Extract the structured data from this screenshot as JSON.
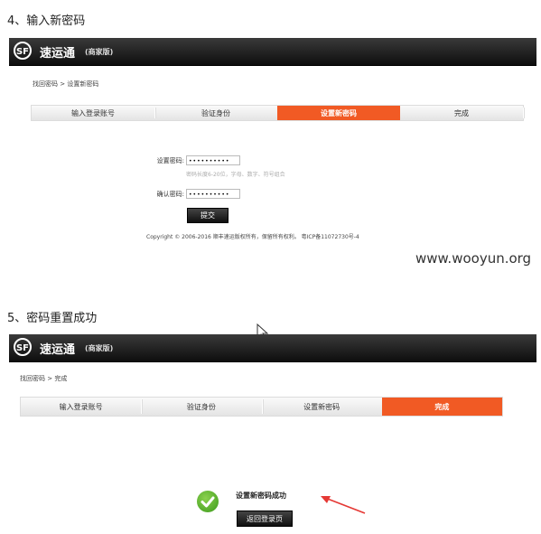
{
  "section1": {
    "heading": "4、输入新密码",
    "brand": {
      "logo": "SF",
      "name": "速运通",
      "edition": "(商家版)"
    },
    "breadcrumb": "找回密码 > 设置新密码",
    "steps": [
      {
        "label": "输入登录账号",
        "active": false
      },
      {
        "label": "验证身份",
        "active": false
      },
      {
        "label": "设置新密码",
        "active": true
      },
      {
        "label": "完成",
        "active": false
      }
    ],
    "form": {
      "password_label": "设置密码:",
      "password_value": "••••••••••",
      "password_hint": "密码长度6-20位，字母、数字、符号组合",
      "confirm_label": "确认密码:",
      "confirm_value": "••••••••••",
      "submit_label": "提交"
    },
    "footer": "Copyright © 2006-2016 顺丰速运版权所有，保留所有权利。 粤ICP备11072730号-4"
  },
  "watermark": "www.wooyun.org",
  "section2": {
    "heading": "5、密码重置成功",
    "brand": {
      "logo": "SF",
      "name": "速运通",
      "edition": "(商家版)"
    },
    "breadcrumb": "找回密码 > 完成",
    "steps": [
      {
        "label": "输入登录账号",
        "active": false
      },
      {
        "label": "验证身份",
        "active": false
      },
      {
        "label": "设置新密码",
        "active": false
      },
      {
        "label": "完成",
        "active": true
      }
    ],
    "success_message": "设置新密码成功",
    "return_label": "返回登录页"
  },
  "colors": {
    "accent": "#f15a24",
    "header": "#1a1a1a",
    "success": "#4caf26",
    "arrow": "#e53935"
  }
}
